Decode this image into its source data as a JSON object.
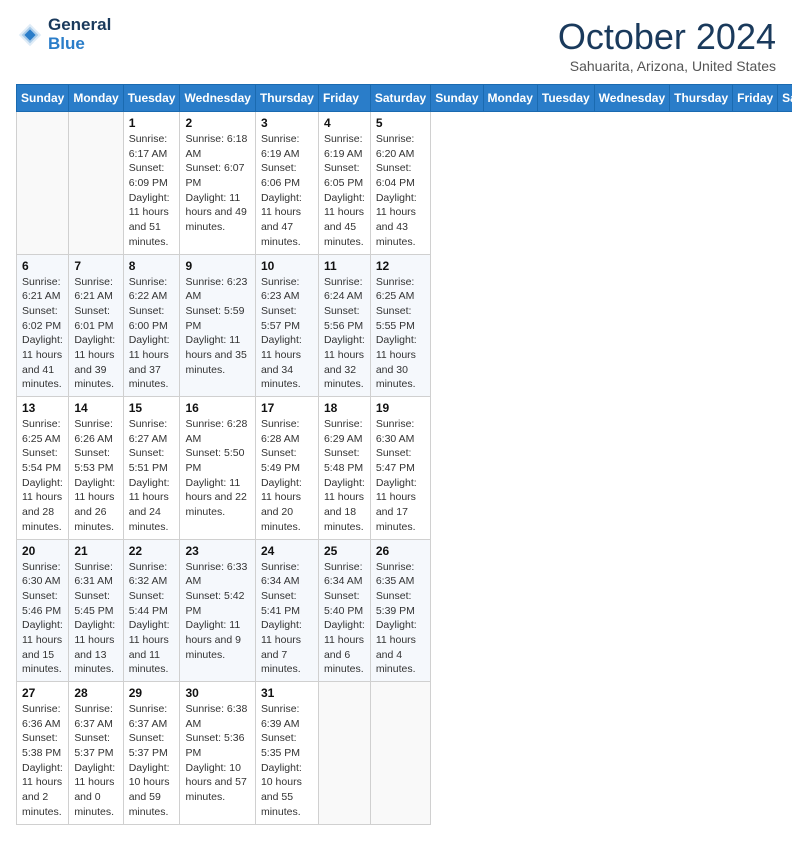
{
  "header": {
    "logo_line1": "General",
    "logo_line2": "Blue",
    "month": "October 2024",
    "location": "Sahuarita, Arizona, United States"
  },
  "days_of_week": [
    "Sunday",
    "Monday",
    "Tuesday",
    "Wednesday",
    "Thursday",
    "Friday",
    "Saturday"
  ],
  "weeks": [
    [
      {
        "day": "",
        "sunrise": "",
        "sunset": "",
        "daylight": ""
      },
      {
        "day": "",
        "sunrise": "",
        "sunset": "",
        "daylight": ""
      },
      {
        "day": "1",
        "sunrise": "Sunrise: 6:17 AM",
        "sunset": "Sunset: 6:09 PM",
        "daylight": "Daylight: 11 hours and 51 minutes."
      },
      {
        "day": "2",
        "sunrise": "Sunrise: 6:18 AM",
        "sunset": "Sunset: 6:07 PM",
        "daylight": "Daylight: 11 hours and 49 minutes."
      },
      {
        "day": "3",
        "sunrise": "Sunrise: 6:19 AM",
        "sunset": "Sunset: 6:06 PM",
        "daylight": "Daylight: 11 hours and 47 minutes."
      },
      {
        "day": "4",
        "sunrise": "Sunrise: 6:19 AM",
        "sunset": "Sunset: 6:05 PM",
        "daylight": "Daylight: 11 hours and 45 minutes."
      },
      {
        "day": "5",
        "sunrise": "Sunrise: 6:20 AM",
        "sunset": "Sunset: 6:04 PM",
        "daylight": "Daylight: 11 hours and 43 minutes."
      }
    ],
    [
      {
        "day": "6",
        "sunrise": "Sunrise: 6:21 AM",
        "sunset": "Sunset: 6:02 PM",
        "daylight": "Daylight: 11 hours and 41 minutes."
      },
      {
        "day": "7",
        "sunrise": "Sunrise: 6:21 AM",
        "sunset": "Sunset: 6:01 PM",
        "daylight": "Daylight: 11 hours and 39 minutes."
      },
      {
        "day": "8",
        "sunrise": "Sunrise: 6:22 AM",
        "sunset": "Sunset: 6:00 PM",
        "daylight": "Daylight: 11 hours and 37 minutes."
      },
      {
        "day": "9",
        "sunrise": "Sunrise: 6:23 AM",
        "sunset": "Sunset: 5:59 PM",
        "daylight": "Daylight: 11 hours and 35 minutes."
      },
      {
        "day": "10",
        "sunrise": "Sunrise: 6:23 AM",
        "sunset": "Sunset: 5:57 PM",
        "daylight": "Daylight: 11 hours and 34 minutes."
      },
      {
        "day": "11",
        "sunrise": "Sunrise: 6:24 AM",
        "sunset": "Sunset: 5:56 PM",
        "daylight": "Daylight: 11 hours and 32 minutes."
      },
      {
        "day": "12",
        "sunrise": "Sunrise: 6:25 AM",
        "sunset": "Sunset: 5:55 PM",
        "daylight": "Daylight: 11 hours and 30 minutes."
      }
    ],
    [
      {
        "day": "13",
        "sunrise": "Sunrise: 6:25 AM",
        "sunset": "Sunset: 5:54 PM",
        "daylight": "Daylight: 11 hours and 28 minutes."
      },
      {
        "day": "14",
        "sunrise": "Sunrise: 6:26 AM",
        "sunset": "Sunset: 5:53 PM",
        "daylight": "Daylight: 11 hours and 26 minutes."
      },
      {
        "day": "15",
        "sunrise": "Sunrise: 6:27 AM",
        "sunset": "Sunset: 5:51 PM",
        "daylight": "Daylight: 11 hours and 24 minutes."
      },
      {
        "day": "16",
        "sunrise": "Sunrise: 6:28 AM",
        "sunset": "Sunset: 5:50 PM",
        "daylight": "Daylight: 11 hours and 22 minutes."
      },
      {
        "day": "17",
        "sunrise": "Sunrise: 6:28 AM",
        "sunset": "Sunset: 5:49 PM",
        "daylight": "Daylight: 11 hours and 20 minutes."
      },
      {
        "day": "18",
        "sunrise": "Sunrise: 6:29 AM",
        "sunset": "Sunset: 5:48 PM",
        "daylight": "Daylight: 11 hours and 18 minutes."
      },
      {
        "day": "19",
        "sunrise": "Sunrise: 6:30 AM",
        "sunset": "Sunset: 5:47 PM",
        "daylight": "Daylight: 11 hours and 17 minutes."
      }
    ],
    [
      {
        "day": "20",
        "sunrise": "Sunrise: 6:30 AM",
        "sunset": "Sunset: 5:46 PM",
        "daylight": "Daylight: 11 hours and 15 minutes."
      },
      {
        "day": "21",
        "sunrise": "Sunrise: 6:31 AM",
        "sunset": "Sunset: 5:45 PM",
        "daylight": "Daylight: 11 hours and 13 minutes."
      },
      {
        "day": "22",
        "sunrise": "Sunrise: 6:32 AM",
        "sunset": "Sunset: 5:44 PM",
        "daylight": "Daylight: 11 hours and 11 minutes."
      },
      {
        "day": "23",
        "sunrise": "Sunrise: 6:33 AM",
        "sunset": "Sunset: 5:42 PM",
        "daylight": "Daylight: 11 hours and 9 minutes."
      },
      {
        "day": "24",
        "sunrise": "Sunrise: 6:34 AM",
        "sunset": "Sunset: 5:41 PM",
        "daylight": "Daylight: 11 hours and 7 minutes."
      },
      {
        "day": "25",
        "sunrise": "Sunrise: 6:34 AM",
        "sunset": "Sunset: 5:40 PM",
        "daylight": "Daylight: 11 hours and 6 minutes."
      },
      {
        "day": "26",
        "sunrise": "Sunrise: 6:35 AM",
        "sunset": "Sunset: 5:39 PM",
        "daylight": "Daylight: 11 hours and 4 minutes."
      }
    ],
    [
      {
        "day": "27",
        "sunrise": "Sunrise: 6:36 AM",
        "sunset": "Sunset: 5:38 PM",
        "daylight": "Daylight: 11 hours and 2 minutes."
      },
      {
        "day": "28",
        "sunrise": "Sunrise: 6:37 AM",
        "sunset": "Sunset: 5:37 PM",
        "daylight": "Daylight: 11 hours and 0 minutes."
      },
      {
        "day": "29",
        "sunrise": "Sunrise: 6:37 AM",
        "sunset": "Sunset: 5:37 PM",
        "daylight": "Daylight: 10 hours and 59 minutes."
      },
      {
        "day": "30",
        "sunrise": "Sunrise: 6:38 AM",
        "sunset": "Sunset: 5:36 PM",
        "daylight": "Daylight: 10 hours and 57 minutes."
      },
      {
        "day": "31",
        "sunrise": "Sunrise: 6:39 AM",
        "sunset": "Sunset: 5:35 PM",
        "daylight": "Daylight: 10 hours and 55 minutes."
      },
      {
        "day": "",
        "sunrise": "",
        "sunset": "",
        "daylight": ""
      },
      {
        "day": "",
        "sunrise": "",
        "sunset": "",
        "daylight": ""
      }
    ]
  ]
}
